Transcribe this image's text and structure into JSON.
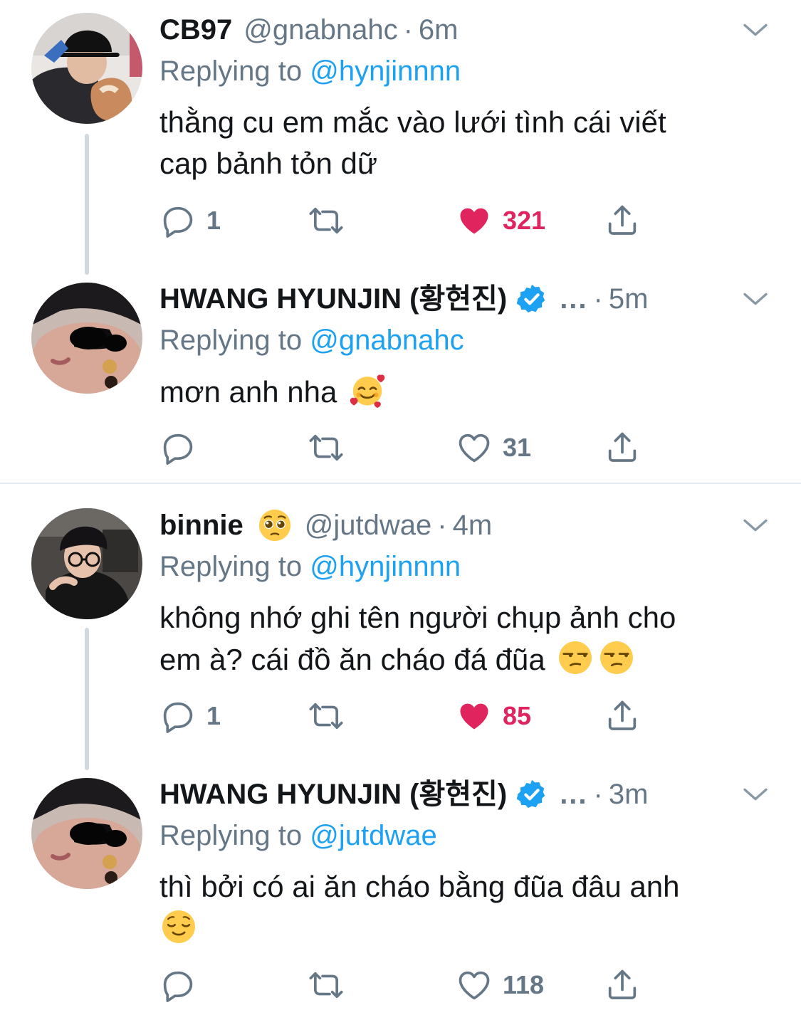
{
  "tweets": [
    {
      "name": "CB97",
      "handle": "@gnabnahc",
      "dot": "·",
      "time": "6m",
      "replying_prefix": "Replying to ",
      "replying_to": "@hynjinnnn",
      "text_line1": "thằng cu em mắc vào lưới tình cái viết",
      "text_line2": "cap bảnh tỏn dữ",
      "reply_count": "1",
      "like_count": "321",
      "liked": true
    },
    {
      "name": "HWANG HYUNJIN (황현진)",
      "verified": true,
      "ellipsis": "...",
      "dot": "·",
      "time": "5m",
      "replying_prefix": "Replying to ",
      "replying_to": "@gnabnahc",
      "text_line1": "mơn anh nha",
      "reply_count": "",
      "like_count": "31",
      "liked": false
    },
    {
      "name": "binnie",
      "handle": "@jutdwae",
      "dot": "·",
      "time": "4m",
      "replying_prefix": "Replying to ",
      "replying_to": "@hynjinnnn",
      "text_line1": "không nhớ ghi tên người chụp ảnh cho",
      "text_line2": "em à? cái đồ ăn cháo đá đũa",
      "reply_count": "1",
      "like_count": "85",
      "liked": true
    },
    {
      "name": "HWANG HYUNJIN (황현진)",
      "verified": true,
      "ellipsis": "...",
      "dot": "·",
      "time": "3m",
      "replying_prefix": "Replying to ",
      "replying_to": "@jutdwae",
      "text_line1": "thì bởi có ai ăn cháo bằng đũa đâu anh",
      "reply_count": "",
      "like_count": "118",
      "liked": false
    }
  ],
  "icons": {
    "reply": "speech-bubble-icon",
    "retweet": "retweet-arrows-icon",
    "like": "heart-icon",
    "share": "share-upload-icon",
    "more": "chevron-down-icon",
    "verified": "verified-badge-icon"
  },
  "colors": {
    "like": "#e0245e",
    "mention": "#1da1f2",
    "muted": "#657786",
    "verified": "#1da1f2"
  }
}
